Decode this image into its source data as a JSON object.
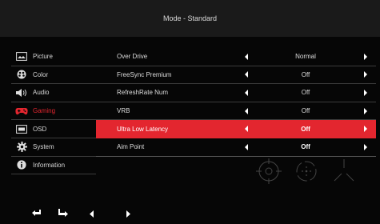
{
  "header": {
    "title": "Mode - Standard"
  },
  "sidebar": {
    "items": [
      {
        "label": "Picture",
        "icon": "picture-icon",
        "active": false
      },
      {
        "label": "Color",
        "icon": "color-icon",
        "active": false
      },
      {
        "label": "Audio",
        "icon": "audio-icon",
        "active": false
      },
      {
        "label": "Gaming",
        "icon": "gamepad-icon",
        "active": true
      },
      {
        "label": "OSD",
        "icon": "osd-icon",
        "active": false
      },
      {
        "label": "System",
        "icon": "gear-icon",
        "active": false
      },
      {
        "label": "Information",
        "icon": "info-icon",
        "active": false
      }
    ]
  },
  "settings": {
    "rows": [
      {
        "label": "Over Drive",
        "value": "Normal"
      },
      {
        "label": "FreeSync Premium",
        "value": "Off"
      },
      {
        "label": "RefreshRate Num",
        "value": "Off"
      },
      {
        "label": "VRB",
        "value": "Off"
      },
      {
        "label": "Ultra Low Latency",
        "value": "Off",
        "selected": true
      },
      {
        "label": "Aim Point",
        "value": "Off"
      }
    ]
  },
  "aim_point_icons": [
    "crosshair-circle-dot-icon",
    "crosshair-dashed-circle-icon",
    "crosshair-tri-line-icon"
  ],
  "bottom_bar": {
    "buttons": [
      "back-arrow-icon",
      "enter-arrow-icon",
      "left-arrow-icon",
      "right-arrow-icon"
    ]
  },
  "colors": {
    "accent": "#e3262f",
    "header_bg": "#1a1a1a",
    "background": "#060606",
    "divider": "#3a3a3a"
  }
}
